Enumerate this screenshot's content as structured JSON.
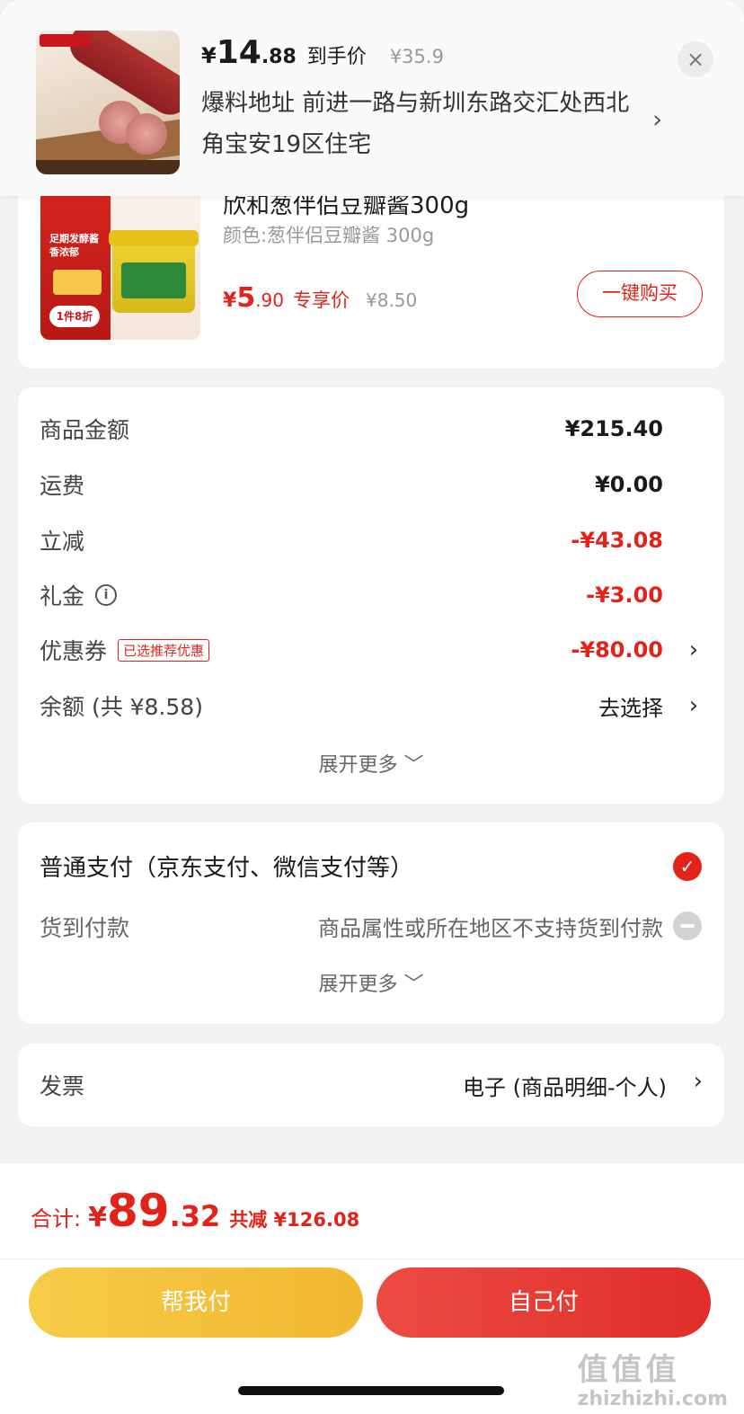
{
  "popup": {
    "price_yen": "¥",
    "price_int": "14",
    "price_dec": ".88",
    "price_label": "到手价",
    "orig_price": "¥35.9",
    "address": "爆料地址  前进一路与新圳东路交汇处西北角宝安19区住宅",
    "close": "×",
    "chevron": "›"
  },
  "product": {
    "title_partial": "欣和葱伴侣豆瓣酱300g",
    "spec": "颜色:葱伴侣豆瓣酱 300g",
    "price_yen": "¥",
    "price_int": "5",
    "price_dec": ".90",
    "price_label": "专享价",
    "orig_price": "¥8.50",
    "buy_label": "一键购买",
    "img_text": "足期发酵酱香浓郁",
    "img_tag": "1件8折"
  },
  "amounts": {
    "rows": [
      {
        "label": "商品金额",
        "value": "¥215.40"
      },
      {
        "label": "运费",
        "value": "¥0.00"
      },
      {
        "label": "立减",
        "value": "-¥43.08"
      },
      {
        "label": "礼金",
        "value": "-¥3.00"
      },
      {
        "label": "优惠券",
        "value": "-¥80.00",
        "tag": "已选推荐优惠"
      },
      {
        "label": "余额 (共 ¥8.58)",
        "value": "去选择"
      }
    ],
    "info_icon": "i",
    "chevron": "›",
    "expand": "展开更多 ﹀"
  },
  "payment": {
    "normal_label": "普通支付（京东支付、微信支付等）",
    "check": "✓",
    "cod_label": "货到付款",
    "cod_note": "商品属性或所在地区不支持货到付款",
    "expand": "展开更多 ﹀"
  },
  "invoice": {
    "label": "发票",
    "value": "电子 (商品明细-个人)",
    "chevron": "›"
  },
  "footer": {
    "total_label": "合计:",
    "total_yen": "¥",
    "total_int": "89",
    "total_dec": ".32",
    "save": "共减 ¥126.08",
    "help_pay": "帮我付",
    "self_pay": "自己付"
  },
  "watermark": {
    "big": "值值值",
    "small": "zhizhizhi.com"
  },
  "colors": {
    "accent": "#e2231a",
    "help_btn": "#f4c23c",
    "self_btn": "#e63b35"
  }
}
